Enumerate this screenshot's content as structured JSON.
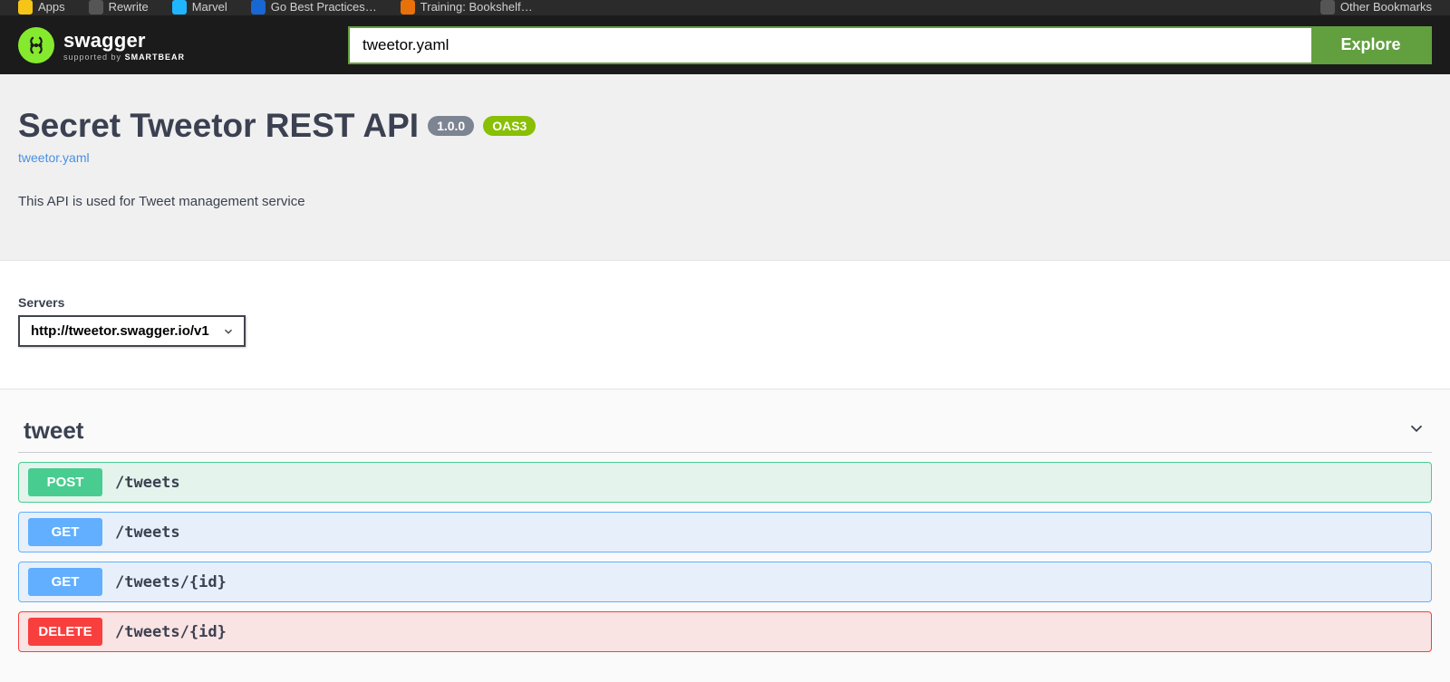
{
  "browser_bar": {
    "items": [
      {
        "label": "Apps"
      },
      {
        "label": "Rewrite"
      },
      {
        "label": "Marvel"
      },
      {
        "label": "Go Best Practices…"
      },
      {
        "label": "Training: Bookshelf…"
      }
    ],
    "other_bookmarks": "Other Bookmarks"
  },
  "topbar": {
    "brand": "swagger",
    "supported_by": "supported by",
    "company": "SMARTBEAR",
    "input_value": "tweetor.yaml",
    "explore_label": "Explore"
  },
  "info": {
    "title": "Secret Tweetor REST API",
    "version": "1.0.0",
    "oas": "OAS3",
    "spec_link": "tweetor.yaml",
    "description": "This API is used for Tweet management service"
  },
  "servers": {
    "label": "Servers",
    "selected": "http://tweetor.swagger.io/v1"
  },
  "tag": {
    "name": "tweet",
    "operations": [
      {
        "method": "POST",
        "path": "/tweets",
        "kind": "post"
      },
      {
        "method": "GET",
        "path": "/tweets",
        "kind": "get"
      },
      {
        "method": "GET",
        "path": "/tweets/{id}",
        "kind": "get"
      },
      {
        "method": "DELETE",
        "path": "/tweets/{id}",
        "kind": "delete"
      }
    ]
  }
}
